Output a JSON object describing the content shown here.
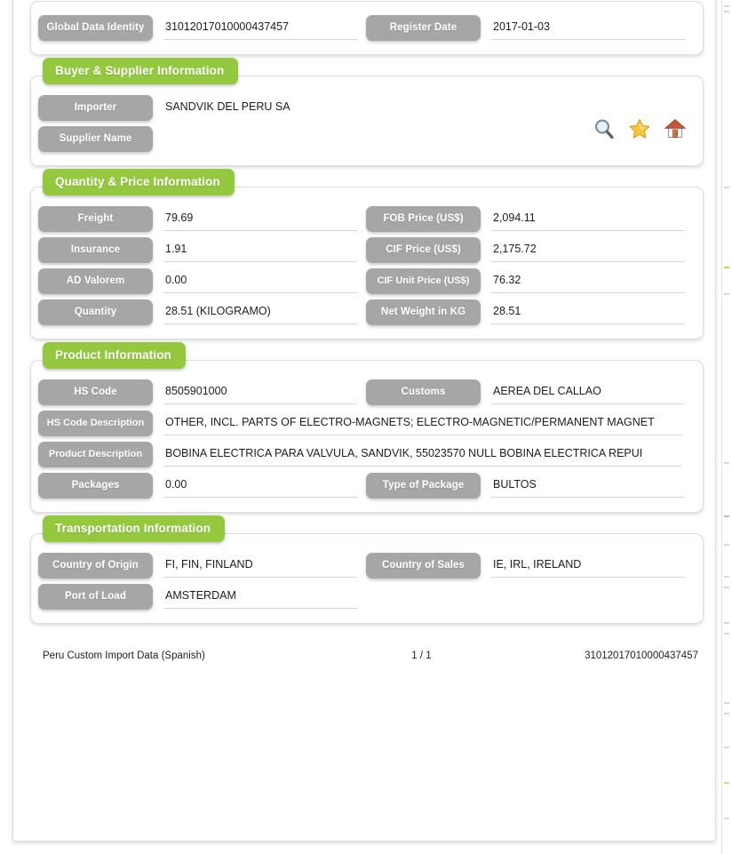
{
  "document": {
    "sections": [
      {
        "id": "identity",
        "title": null,
        "fields": [
          {
            "label": "Global Data Identity",
            "value": "31012017010000437457"
          },
          {
            "label": "Register Date",
            "value": "2017-01-03"
          }
        ]
      },
      {
        "id": "buyer-supplier",
        "title": "Buyer & Supplier Information",
        "fields": [
          {
            "label": "Importer",
            "value": "SANDVIK DEL PERU SA"
          },
          {
            "label": "Supplier Name",
            "value": ""
          }
        ],
        "actions": [
          {
            "name": "search-icon",
            "title": "Search"
          },
          {
            "name": "star-icon",
            "title": "Favorite"
          },
          {
            "name": "home-icon",
            "title": "Home"
          }
        ]
      },
      {
        "id": "quantity-price",
        "title": "Quantity & Price Information",
        "fields": [
          {
            "label": "Freight",
            "value": "79.69"
          },
          {
            "label": "FOB Price (US$)",
            "value": "2,094.11"
          },
          {
            "label": "Insurance",
            "value": "1.91"
          },
          {
            "label": "CIF Price (US$)",
            "value": "2,175.72"
          },
          {
            "label": "AD Valorem",
            "value": "0.00"
          },
          {
            "label": "CIF Unit Price (US$)",
            "value": "76.32"
          },
          {
            "label": "Quantity",
            "value": "28.51 (KILOGRAMO)"
          },
          {
            "label": "Net Weight in KG",
            "value": "28.51"
          }
        ]
      },
      {
        "id": "product",
        "title": "Product Information",
        "fields": [
          {
            "label": "HS Code",
            "value": "8505901000"
          },
          {
            "label": "Customs",
            "value": "AEREA DEL CALLAO"
          },
          {
            "label": "HS Code Description",
            "value": "OTHER, INCL. PARTS OF ELECTRO-MAGNETS; ELECTRO-MAGNETIC/PERMANENT MAGNET"
          },
          {
            "label": "Product Description",
            "value": "BOBINA ELECTRICA PARA VALVULA, SANDVIK, 55023570 NULL BOBINA ELECTRICA REPUI"
          },
          {
            "label": "Packages",
            "value": "0.00"
          },
          {
            "label": "Type of Package",
            "value": "BULTOS"
          }
        ]
      },
      {
        "id": "transportation",
        "title": "Transportation Information",
        "fields": [
          {
            "label": "Country of Origin",
            "value": "FI, FIN, FINLAND"
          },
          {
            "label": "Country of Sales",
            "value": "IE, IRL, IRELAND"
          },
          {
            "label": "Port of Load",
            "value": "AMSTERDAM"
          }
        ]
      }
    ],
    "footer": {
      "source": "Peru Custom Import Data (Spanish)",
      "page": "1 / 1",
      "identity": "31012017010000437457"
    }
  },
  "theme": {
    "accent_green": "#93c83f",
    "label_gray": "#a6a6a6",
    "text_dark": "#1d1d1d",
    "underline": "#d5d5d5"
  }
}
